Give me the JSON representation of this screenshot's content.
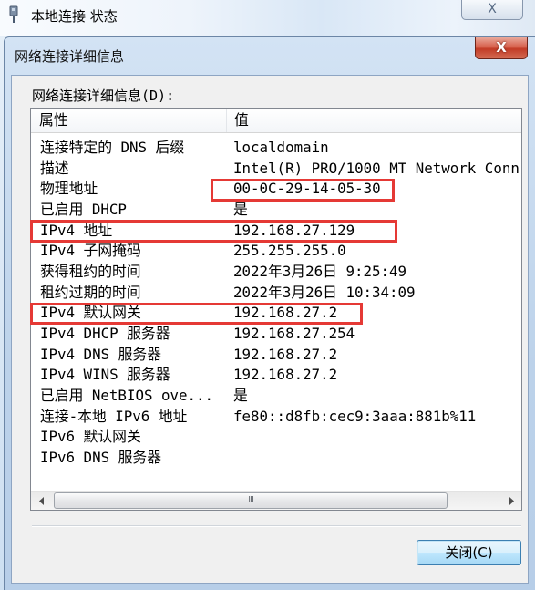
{
  "parent_window": {
    "title": "本地连接 状态",
    "icon": "network-connection-icon",
    "close_glyph": "X"
  },
  "dialog": {
    "title": "网络连接详细信息",
    "close_glyph": "X",
    "list_label": "网络连接详细信息(D):",
    "columns": {
      "property": "属性",
      "value": "值"
    },
    "rows": [
      {
        "property": "连接特定的 DNS 后缀",
        "value": "localdomain"
      },
      {
        "property": "描述",
        "value": "Intel(R) PRO/1000 MT Network Conn"
      },
      {
        "property": "物理地址",
        "value": "00-0C-29-14-05-30"
      },
      {
        "property": "已启用 DHCP",
        "value": "是"
      },
      {
        "property": "IPv4 地址",
        "value": "192.168.27.129"
      },
      {
        "property": "IPv4 子网掩码",
        "value": "255.255.255.0"
      },
      {
        "property": "获得租约的时间",
        "value": "2022年3月26日 9:25:49"
      },
      {
        "property": "租约过期的时间",
        "value": "2022年3月26日 10:34:09"
      },
      {
        "property": "IPv4 默认网关",
        "value": "192.168.27.2"
      },
      {
        "property": "IPv4 DHCP 服务器",
        "value": "192.168.27.254"
      },
      {
        "property": "IPv4 DNS 服务器",
        "value": "192.168.27.2"
      },
      {
        "property": "IPv4 WINS 服务器",
        "value": "192.168.27.2"
      },
      {
        "property": "已启用 NetBIOS ove...",
        "value": "是"
      },
      {
        "property": "连接-本地 IPv6 地址",
        "value": "fe80::d8fb:cec9:3aaa:881b%11"
      },
      {
        "property": "IPv6 默认网关",
        "value": ""
      },
      {
        "property": "IPv6 DNS 服务器",
        "value": ""
      }
    ],
    "scrollbar": {
      "left_icon": "scroll-left-arrow-icon",
      "right_icon": "scroll-right-arrow-icon",
      "grip": "III"
    },
    "close_button_label": "关闭(C)"
  },
  "colors": {
    "annotation": "#e53935",
    "close_button_red": "#c23b26",
    "default_button_border": "#3c7fb1",
    "dialog_background": "#f0f0f0"
  }
}
